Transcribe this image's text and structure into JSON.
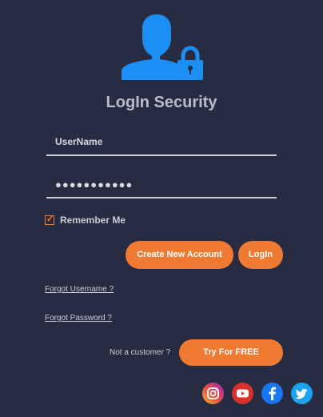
{
  "header": {
    "title": "LogIn Security"
  },
  "form": {
    "username_value": "UserName",
    "password_value": "●●●●●●●●●●●",
    "remember_label": "Remember Me",
    "remember_checked": true
  },
  "buttons": {
    "create_account": "Create New Account",
    "login": "LogIn",
    "try_free": "Try For FREE"
  },
  "links": {
    "forgot_username": "Forgot Username ?",
    "forgot_password": "Forgot Password ?"
  },
  "signup_prompt": "Not a customer ?",
  "social": [
    "instagram-icon",
    "youtube-icon",
    "facebook-icon",
    "twitter-icon"
  ],
  "colors": {
    "background": "#282c42",
    "accent": "#f07a32",
    "logo": "#1c8ff5"
  }
}
